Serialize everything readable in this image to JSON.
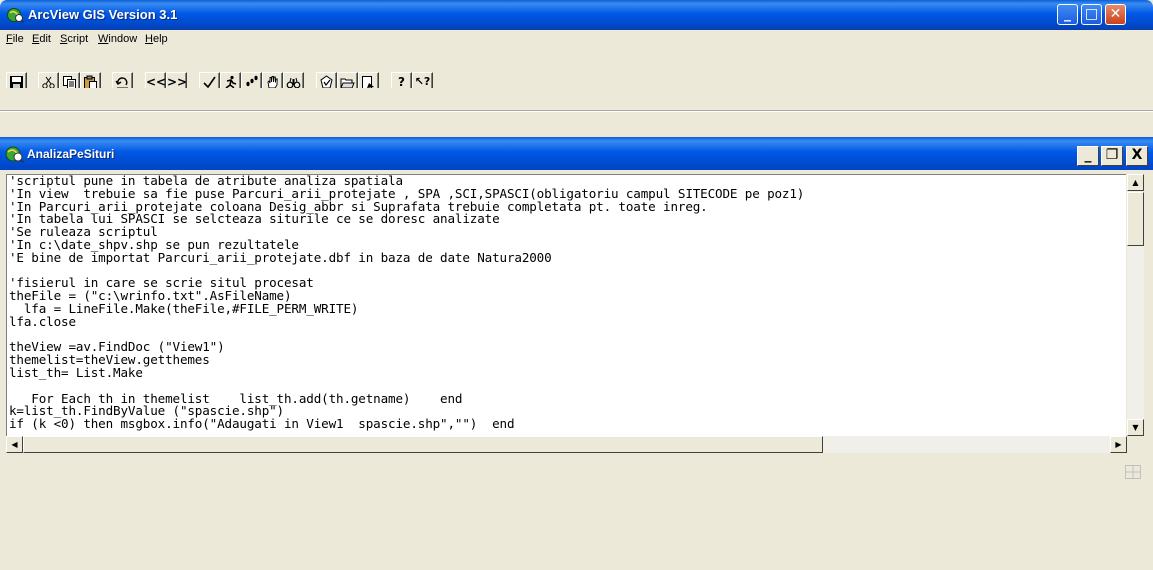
{
  "window": {
    "title": "ArcView GIS Version 3.1",
    "minimize_label": "_",
    "maximize_label": "□",
    "close_label": "✕"
  },
  "menu": {
    "items": [
      {
        "label": "File",
        "underline": "F",
        "rest": "ile"
      },
      {
        "label": "Edit",
        "underline": "E",
        "rest": "dit"
      },
      {
        "label": "Script",
        "underline": "S",
        "rest": "cript"
      },
      {
        "label": "Window",
        "underline": "W",
        "rest": "indow"
      },
      {
        "label": "Help",
        "underline": "H",
        "rest": "elp"
      }
    ]
  },
  "toolbar": {
    "prev_label": "<<",
    "next_label": ">>",
    "help_label": "?",
    "help_pointer_label": "↖?"
  },
  "document": {
    "title": "AnalizaPeSituri",
    "minimize_label": "_",
    "restore_label": "❐",
    "close_label": "X"
  },
  "script": {
    "lines": [
      "'scriptul pune in tabela de atribute analiza spatiala",
      "'In view  trebuie sa fie puse Parcuri_arii_protejate , SPA ,SCI,SPASCI(obligatoriu campul SITECODE pe poz1)",
      "'In Parcuri_arii_protejate coloana Desig_abbr si Suprafata trebuie completata pt. toate inreg.",
      "'In tabela lui SPASCI se selcteaza siturile ce se doresc analizate",
      "'Se ruleaza scriptul",
      "'In c:\\date_shpv.shp se pun rezultatele",
      "'E bine de importat Parcuri_arii_protejate.dbf in baza de date Natura2000",
      "",
      "'fisierul in care se scrie situl procesat",
      "theFile = (\"c:\\wrinfo.txt\".AsFileName)",
      "  lfa = LineFile.Make(theFile,#FILE_PERM_WRITE)",
      "lfa.close",
      "",
      "theView =av.FindDoc (\"View1\")",
      "themelist=theView.getthemes",
      "list_th= List.Make",
      "",
      "   For Each th in themelist    list_th.add(th.getname)    end",
      "k=list_th.FindByValue (\"spascie.shp\")",
      "if (k <0) then msgbox.info(\"Adaugati in View1  spascie.shp\",\"\")  end"
    ]
  }
}
